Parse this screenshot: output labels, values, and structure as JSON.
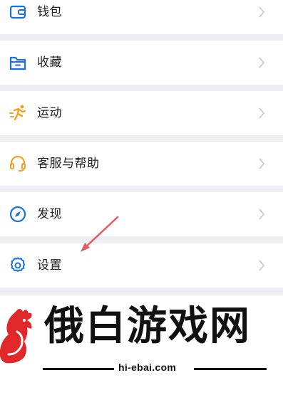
{
  "menu": {
    "items": [
      {
        "label": "钱包",
        "icon": "wallet-icon"
      },
      {
        "label": "收藏",
        "icon": "favorites-box-icon"
      },
      {
        "label": "运动",
        "icon": "running-person-icon"
      },
      {
        "label": "客服与帮助",
        "icon": "headset-icon"
      },
      {
        "label": "发现",
        "icon": "compass-icon"
      },
      {
        "label": "设置",
        "icon": "gear-icon"
      }
    ]
  },
  "watermark": {
    "brand": "俄白游戏网",
    "url": "hi-ebai.com"
  },
  "colors": {
    "icon_blue": "#1a6fe0",
    "icon_orange": "#f5a020",
    "annotation_red": "#e25b62",
    "logo_red": "#e0282a",
    "background": "#ededf2"
  }
}
